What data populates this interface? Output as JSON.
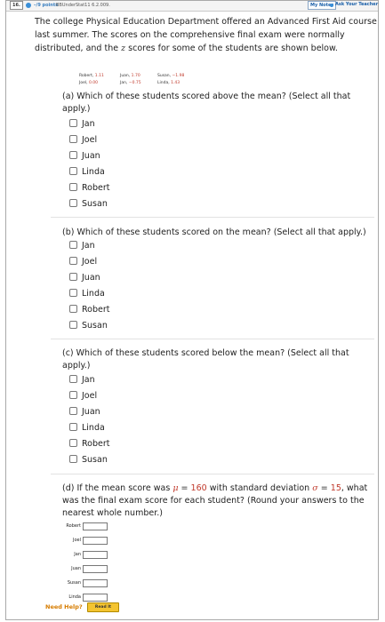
{
  "header": {
    "question_number": "16.",
    "points": "–/9 points",
    "source": "BBUnderStat11 6.2.009.",
    "my_notes": "My Notes",
    "ask_teacher": "Ask Your Teacher"
  },
  "intro": {
    "text_before_z": "The college Physical Education Department offered an Advanced First Aid course last summer. The scores on the comprehensive final exam were normally distributed, and the",
    "z_letter": "z",
    "text_after_z": "scores for some of the students are shown below."
  },
  "scores": [
    {
      "name": "Robert,",
      "value": "1.11"
    },
    {
      "name": "Juan,",
      "value": "1.70"
    },
    {
      "name": "Susan,",
      "value": "−1.98"
    },
    {
      "name": "Joel,",
      "value": "0.00"
    },
    {
      "name": "Jan,",
      "value": "−0.75"
    },
    {
      "name": "Linda,",
      "value": "1.43"
    }
  ],
  "part_a": {
    "prompt": "(a) Which of these students scored above the mean? (Select all that apply.)",
    "options": [
      "Jan",
      "Joel",
      "Juan",
      "Linda",
      "Robert",
      "Susan"
    ]
  },
  "part_b": {
    "prompt": "(b) Which of these students scored on the mean? (Select all that apply.)",
    "options": [
      "Jan",
      "Joel",
      "Juan",
      "Linda",
      "Robert",
      "Susan"
    ]
  },
  "part_c": {
    "prompt": "(c) Which of these students scored below the mean? (Select all that apply.)",
    "options": [
      "Jan",
      "Joel",
      "Juan",
      "Linda",
      "Robert",
      "Susan"
    ]
  },
  "part_d": {
    "text1": "(d) If the mean score was",
    "mu": "μ",
    "eq1": "=",
    "mean": "160",
    "text2": "with standard deviation",
    "sigma": "σ",
    "eq2": "=",
    "sd": "15",
    "text3": ", what was the final exam score for each student? (Round your answers to the nearest whole number.)",
    "rows": [
      {
        "label": "Robert",
        "value": ""
      },
      {
        "label": "Joel",
        "value": ""
      },
      {
        "label": "Jan",
        "value": ""
      },
      {
        "label": "Juan",
        "value": ""
      },
      {
        "label": "Susan",
        "value": ""
      },
      {
        "label": "Linda",
        "value": ""
      }
    ]
  },
  "help": {
    "label": "Need Help?",
    "read_button": "Read It"
  },
  "colors": {
    "accent_red": "#c0392b",
    "help_orange": "#d67c00",
    "read_button": "#f4c430"
  }
}
